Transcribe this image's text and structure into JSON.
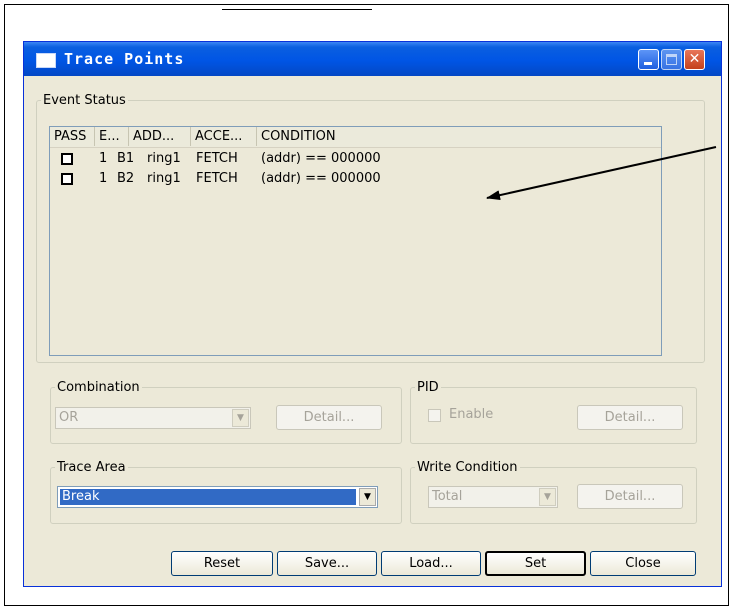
{
  "window": {
    "title": "Trace Points",
    "minimize_icon": "minimize-icon",
    "maximize_icon": "maximize-icon",
    "close_icon": "close-x-icon"
  },
  "event_status": {
    "legend": "Event Status",
    "columns": [
      "PASS",
      "E...",
      "ADD...",
      "ACCE...",
      "CONDITION"
    ],
    "rows": [
      {
        "pass_checked": false,
        "count": "1",
        "event": "B1",
        "address": "ring1",
        "access": "FETCH",
        "condition": "(addr) == 000000"
      },
      {
        "pass_checked": false,
        "count": "1",
        "event": "B2",
        "address": "ring1",
        "access": "FETCH",
        "condition": "(addr) == 000000"
      }
    ]
  },
  "combination": {
    "legend": "Combination",
    "value": "OR",
    "detail_label": "Detail..."
  },
  "pid": {
    "legend": "PID",
    "enable_label": "Enable",
    "enable_checked": false,
    "detail_label": "Detail..."
  },
  "trace_area": {
    "legend": "Trace Area",
    "value": "Break"
  },
  "write_condition": {
    "legend": "Write Condition",
    "value": "Total",
    "detail_label": "Detail..."
  },
  "buttons": {
    "reset": "Reset",
    "save": "Save...",
    "load": "Load...",
    "set": "Set",
    "close": "Close"
  },
  "colors": {
    "titlebar": "#0055e5",
    "dialog_bg": "#ece9d8",
    "selection": "#316ac5",
    "close_button": "#d6522c"
  }
}
